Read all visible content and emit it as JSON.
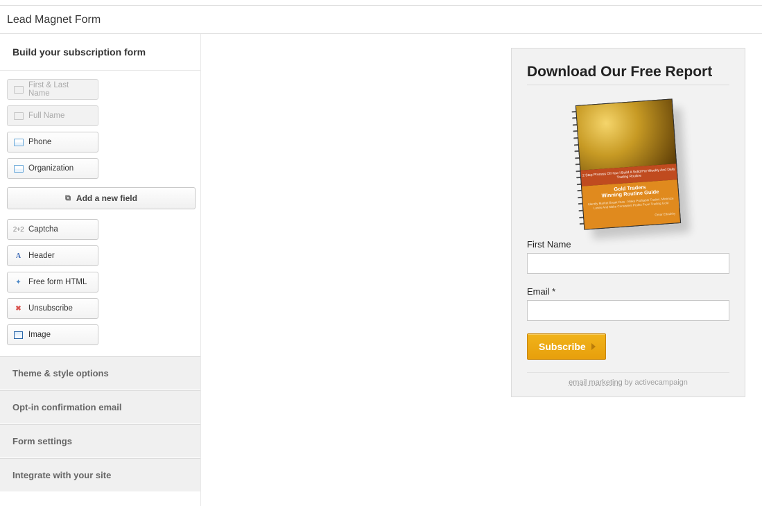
{
  "page": {
    "title": "Lead Magnet Form"
  },
  "sidebar": {
    "heading": "Build your subscription form",
    "fields": {
      "first_last": "First & Last Name",
      "full_name": "Full Name",
      "phone": "Phone",
      "organization": "Organization"
    },
    "add_field": "Add a new field",
    "components": {
      "captcha": "Captcha",
      "header": "Header",
      "free_html": "Free form HTML",
      "unsubscribe": "Unsubscribe",
      "image": "Image"
    },
    "accordion": {
      "theme": "Theme & style options",
      "optin": "Opt-in confirmation email",
      "settings": "Form settings",
      "integrate": "Integrate with your site"
    }
  },
  "preview": {
    "title": "Download Our Free Report",
    "book": {
      "ribbon": "2 Step Process Of How I Build A Solid Pre-Weekly And Daily Trading Routine",
      "title_line1": "Gold Traders",
      "title_line2": "Winning Routine Guide",
      "sub": "Identify Market Break Outs · Make Profitable Trades, Minimize Loses And Make Consistent Profits From Trading Gold",
      "author": "Omar Eltoukhy"
    },
    "fields": {
      "first_name_label": "First Name",
      "email_label": "Email *"
    },
    "subscribe": "Subscribe",
    "credit_link": "email marketing",
    "credit_rest": " by activecampaign"
  }
}
